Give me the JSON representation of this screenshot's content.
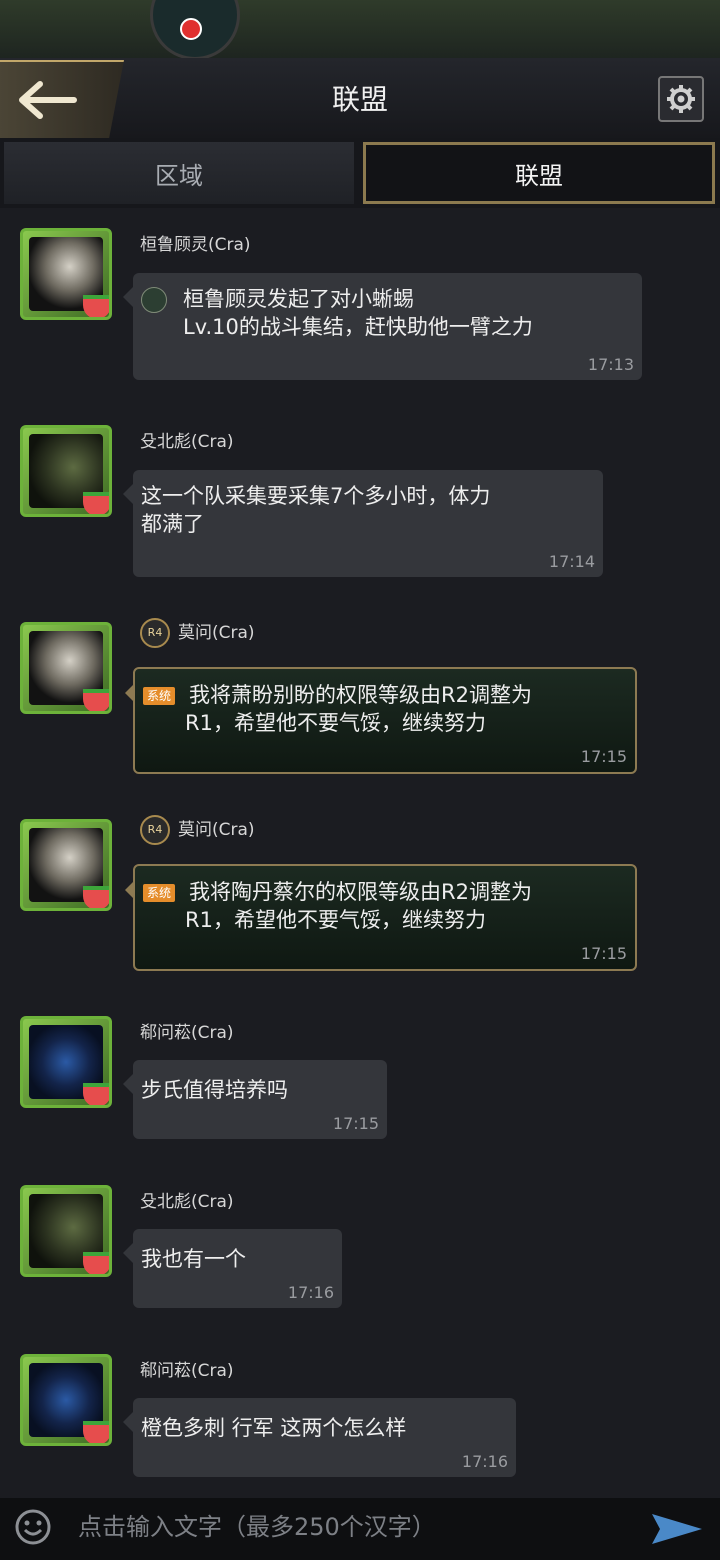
{
  "header": {
    "title": "联盟",
    "back_icon": "back-arrow-icon",
    "settings_icon": "gear-icon"
  },
  "tabs": [
    {
      "label": "区域",
      "selected": false
    },
    {
      "label": "联盟",
      "selected": true
    }
  ],
  "messages": [
    {
      "sender": "桓鲁顾灵(Cra)",
      "badge": "",
      "text_lines": [
        "桓鲁顾灵发起了对小蜥蜴",
        "Lv.10的战斗集结，赶快助他一臂之力"
      ],
      "time": "17:13",
      "type": "rally"
    },
    {
      "sender": "殳北彪(Cra)",
      "badge": "",
      "text_lines": [
        "这一个队采集要采集7个多小时，体力",
        "都满了"
      ],
      "time": "17:14",
      "type": "normal"
    },
    {
      "sender": "莫问(Cra)",
      "badge": "R4",
      "tag": "系统",
      "text_lines": [
        "我将萧盼别盼的权限等级由R2调整为",
        "R1，希望他不要气馁，继续努力"
      ],
      "time": "17:15",
      "type": "system"
    },
    {
      "sender": "莫问(Cra)",
      "badge": "R4",
      "tag": "系统",
      "text_lines": [
        "我将陶丹蔡尔的权限等级由R2调整为",
        "R1，希望他不要气馁，继续努力"
      ],
      "time": "17:15",
      "type": "system"
    },
    {
      "sender": "郗问菘(Cra)",
      "badge": "",
      "text_lines": [
        "步氏值得培养吗"
      ],
      "time": "17:15",
      "type": "normal"
    },
    {
      "sender": "殳北彪(Cra)",
      "badge": "",
      "text_lines": [
        "我也有一个"
      ],
      "time": "17:16",
      "type": "normal"
    },
    {
      "sender": "郗问菘(Cra)",
      "badge": "",
      "text_lines": [
        "橙色多刺 行军 这两个怎么样"
      ],
      "time": "17:16",
      "type": "normal"
    }
  ],
  "composer": {
    "placeholder": "点击输入文字（最多250个汉字）",
    "emoji_icon": "emoji-icon",
    "send_icon": "send-icon"
  },
  "colors": {
    "accent_gold": "#8c7a4f",
    "system_tag": "#e58d2b",
    "background": "#1b1c21"
  }
}
